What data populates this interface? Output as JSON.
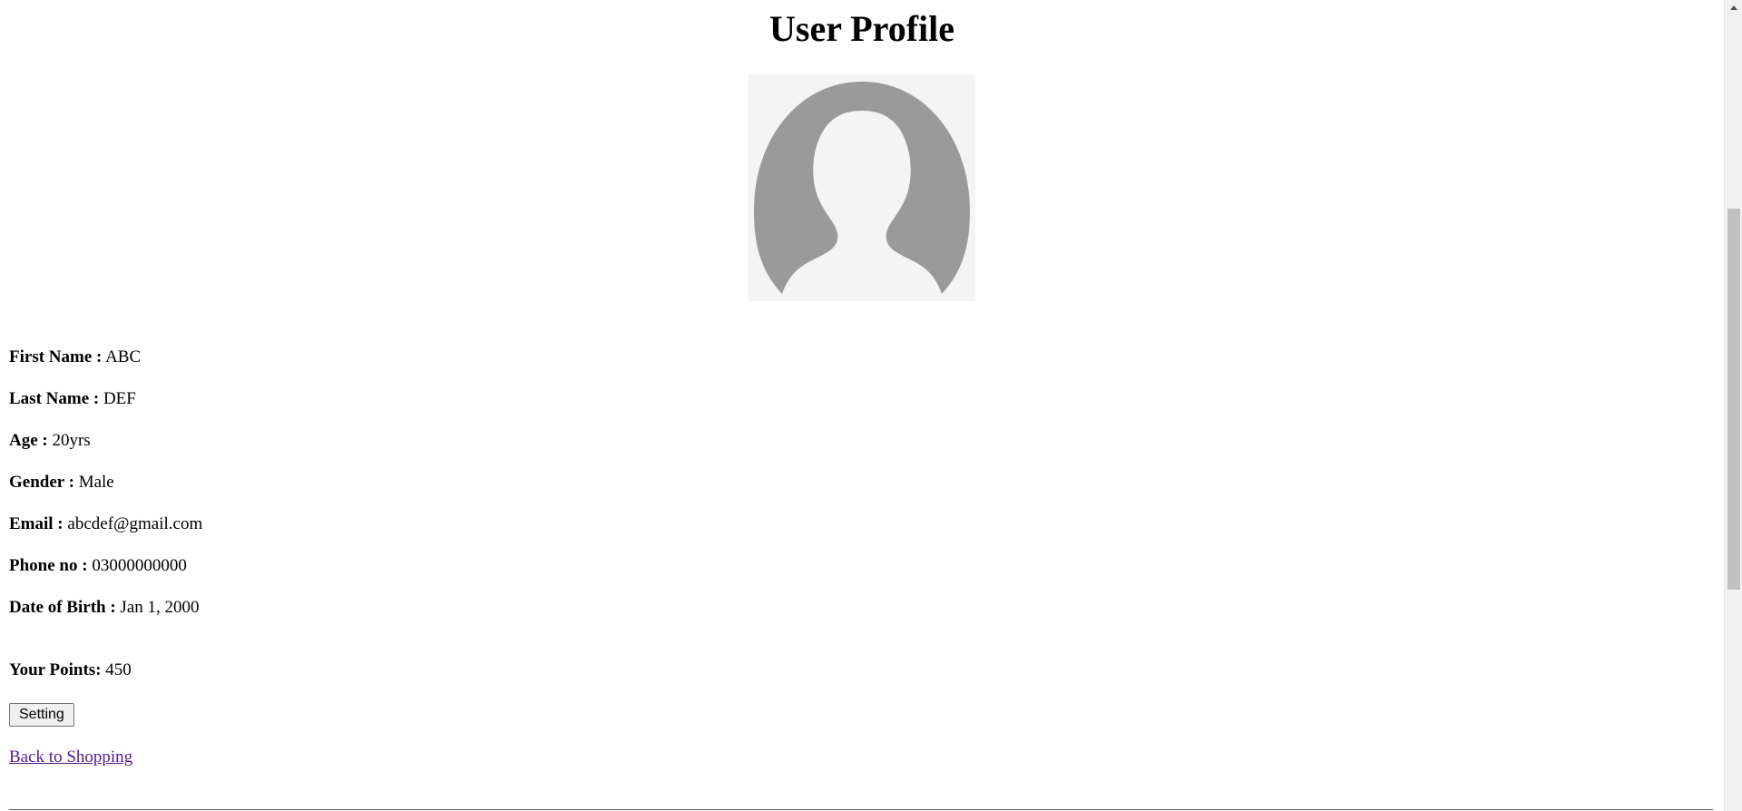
{
  "page": {
    "title": "User Profile"
  },
  "avatar": {
    "icon": "default-user-silhouette",
    "background_color": "#f4f4f4",
    "silhouette_color": "#9a9a9a"
  },
  "profile": {
    "fields": [
      {
        "label": "First Name :",
        "value": "ABC"
      },
      {
        "label": "Last Name :",
        "value": "DEF"
      },
      {
        "label": "Age :",
        "value": "20yrs"
      },
      {
        "label": "Gender :",
        "value": "Male"
      },
      {
        "label": "Email :",
        "value": "abcdef@gmail.com"
      },
      {
        "label": "Phone no :",
        "value": "03000000000"
      },
      {
        "label": "Date of Birth :",
        "value": "Jan 1, 2000"
      }
    ]
  },
  "points": {
    "label": "Your Points:",
    "value": "450"
  },
  "actions": {
    "setting_label": "Setting",
    "back_link_label": "Back to Shopping"
  },
  "colors": {
    "visited_link": "#551a8b",
    "scrollbar_thumb": "#c1c1c1"
  }
}
